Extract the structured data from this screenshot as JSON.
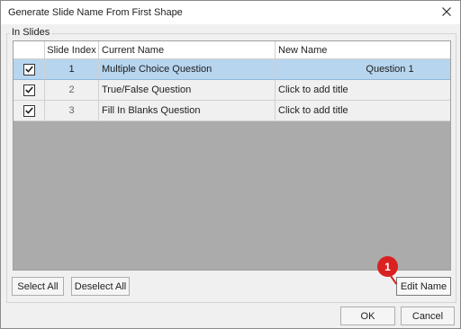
{
  "dialog": {
    "title": "Generate Slide Name From First Shape",
    "close_icon": "close-icon"
  },
  "group": {
    "label": "In Slides"
  },
  "table": {
    "columns": [
      "",
      "Slide Index",
      "Current Name",
      "New Name"
    ],
    "rows": [
      {
        "checked": true,
        "index": "1",
        "current": "Multiple Choice Question",
        "new": "Question 1",
        "selected": true
      },
      {
        "checked": true,
        "index": "2",
        "current": "True/False Question",
        "new": "Click to add title",
        "selected": false
      },
      {
        "checked": true,
        "index": "3",
        "current": "Fill In Blanks Question",
        "new": "Click to add title",
        "selected": false
      }
    ]
  },
  "buttons": {
    "select_all": "Select All",
    "deselect_all": "Deselect All",
    "edit_name": "Edit Name",
    "ok": "OK",
    "cancel": "Cancel"
  },
  "annotation": {
    "step": "1",
    "color": "#d92121"
  },
  "colors": {
    "selected_row": "#b7d5ee",
    "dialog_bg": "#f0f0f0",
    "grid_bg": "#ababab"
  }
}
